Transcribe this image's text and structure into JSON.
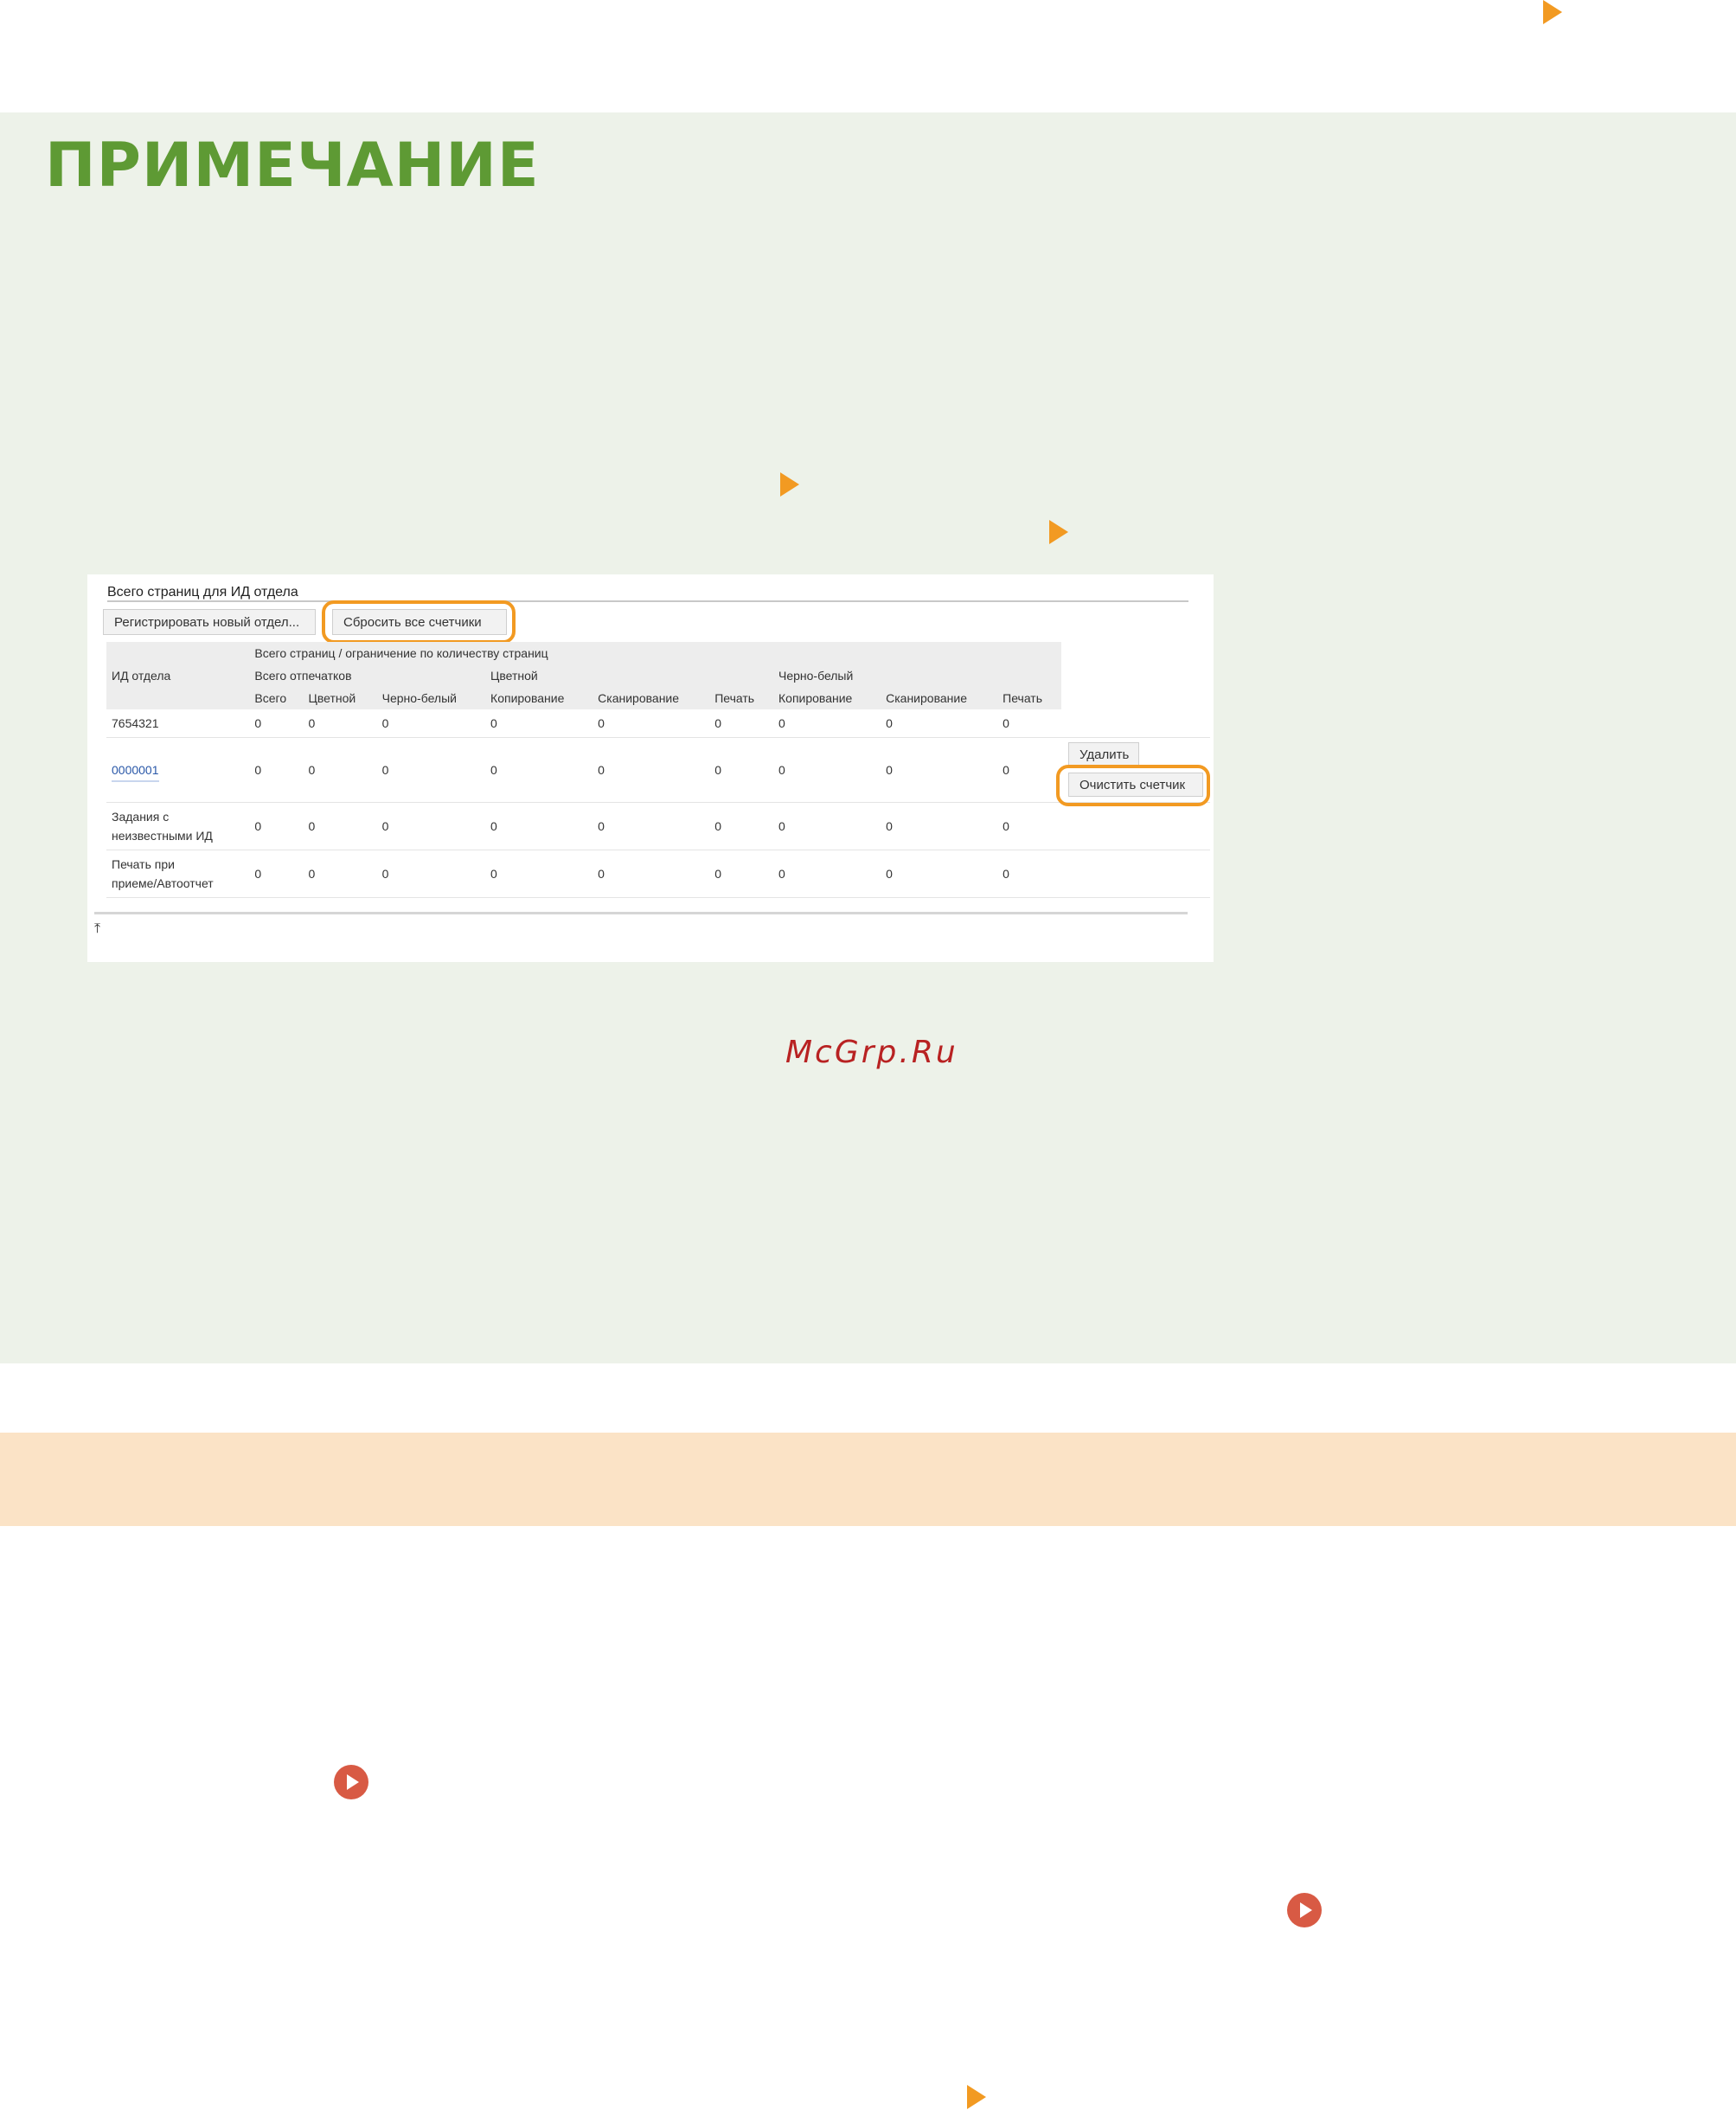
{
  "note": {
    "title": "ПРИМЕЧАНИЕ"
  },
  "watermark": "McGrp.Ru",
  "colors": {
    "accent": "#f29a22",
    "note_title": "#5e9a34",
    "note_bg": "#edf2e9",
    "band": "#fbe3c6"
  },
  "screenshot": {
    "title": "Всего страниц для ИД отдела",
    "register_button": "Регистрировать новый отдел...",
    "reset_all_button": "Сбросить все счетчики",
    "header": {
      "dept_id": "ИД отдела",
      "total_limit": "Всего страниц / ограничение по количеству страниц",
      "groups": {
        "all_prints": "Всего отпечатков",
        "color": "Цветной",
        "bw": "Черно-белый"
      },
      "cols": [
        "Всего",
        "Цветной",
        "Черно-белый",
        "Копирование",
        "Сканирование",
        "Печать",
        "Копирование",
        "Сканирование",
        "Печать"
      ]
    },
    "rows": [
      {
        "id": "7654321",
        "values": [
          "0",
          "0",
          "0",
          "0",
          "0",
          "0",
          "0",
          "0",
          "0"
        ]
      },
      {
        "id": "0000001",
        "values": [
          "0",
          "0",
          "0",
          "0",
          "0",
          "0",
          "0",
          "0",
          "0"
        ]
      },
      {
        "id_line1": "Задания с",
        "id_line2": "неизвестными ИД",
        "values": [
          "0",
          "0",
          "0",
          "0",
          "0",
          "0",
          "0",
          "0",
          "0"
        ]
      },
      {
        "id_line1": "Печать при",
        "id_line2": "приеме/Автоотчет",
        "values": [
          "0",
          "0",
          "0",
          "0",
          "0",
          "0",
          "0",
          "0",
          "0"
        ]
      }
    ],
    "delete_button": "Удалить",
    "clear_counter_button": "Очистить счетчик",
    "top_icon": "to-top-icon"
  }
}
